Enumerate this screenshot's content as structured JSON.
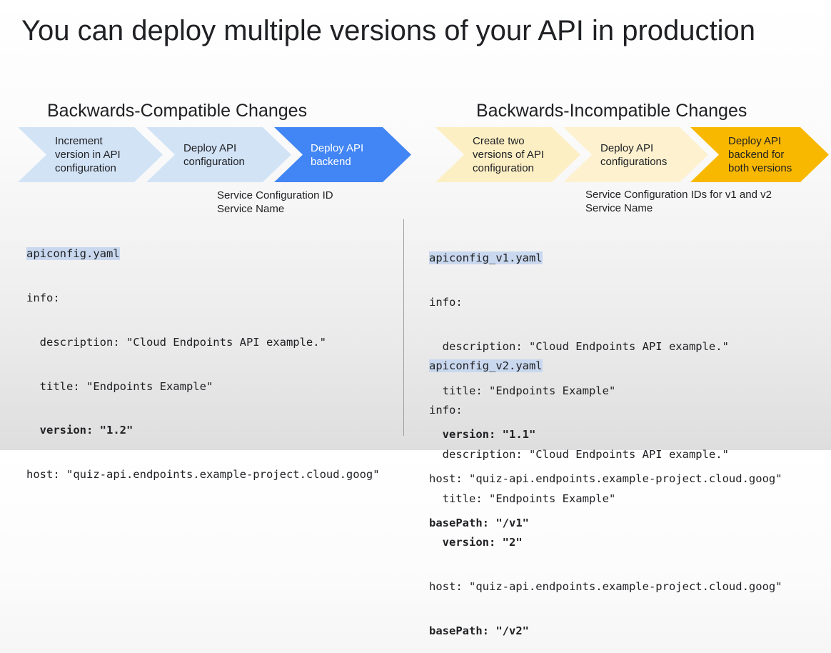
{
  "title": "You can deploy multiple versions of your API in production",
  "left": {
    "heading": "Backwards-Compatible Changes",
    "steps": [
      "Increment version in API configuration",
      "Deploy API configuration",
      "Deploy API backend"
    ],
    "note_line1": "Service Configuration ID",
    "note_line2": "Service Name",
    "file": {
      "name": "apiconfig.yaml",
      "info": "info:",
      "description": "  description: \"Cloud Endpoints API example.\"",
      "title": "  title: \"Endpoints Example\"",
      "version": "  version: \"1.2\"",
      "host": "host: \"quiz-api.endpoints.example-project.cloud.goog\""
    }
  },
  "right": {
    "heading": "Backwards-Incompatible Changes",
    "steps": [
      "Create two versions of API configuration",
      "Deploy API configurations",
      "Deploy API backend for both versions"
    ],
    "note_line1": "Service Configuration IDs for v1 and v2",
    "note_line2": "Service Name",
    "file_v1": {
      "name": "apiconfig_v1.yaml",
      "info": "info:",
      "description": "  description: \"Cloud Endpoints API example.\"",
      "title": "  title: \"Endpoints Example\"",
      "version": "  version: \"1.1\"",
      "host": "host: \"quiz-api.endpoints.example-project.cloud.goog\"",
      "basepath": "basePath: \"/v1\""
    },
    "file_v2": {
      "name": "apiconfig_v2.yaml",
      "info": "info:",
      "description": "  description: \"Cloud Endpoints API example.\"",
      "title": "  title: \"Endpoints Example\"",
      "version": "  version: \"2\"",
      "host": "host: \"quiz-api.endpoints.example-project.cloud.goog\"",
      "basepath": "basePath: \"/v2\""
    }
  },
  "colors": {
    "blue_light": "#d2e3f6",
    "blue": "#4285f4",
    "yellow_light": "#fdefc4",
    "yellow": "#f9b800",
    "highlight": "#c9d8ee"
  }
}
